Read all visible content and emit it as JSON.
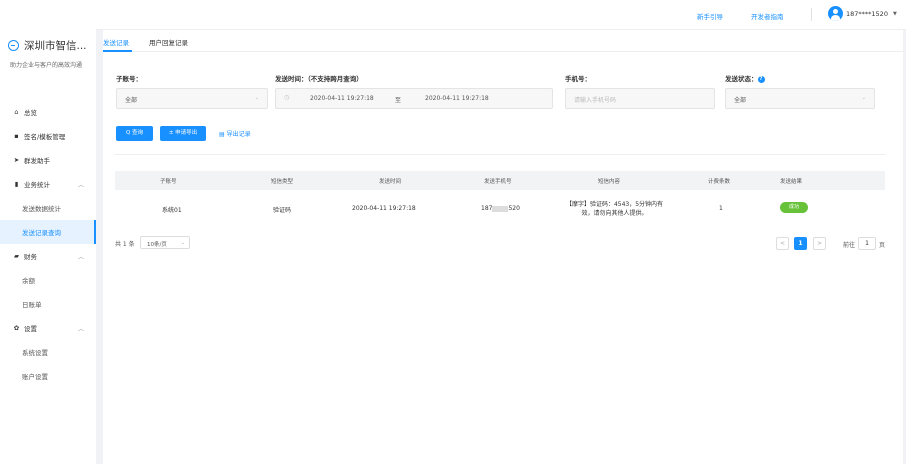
{
  "brand": {
    "name": "深圳市智信...",
    "subtitle": "助力企业与客户的高效沟通"
  },
  "sidebar": {
    "items": [
      {
        "label": "总览",
        "icon": "home-icon",
        "glyph": "⌂"
      },
      {
        "label": "签名/模板管理",
        "icon": "grid-icon",
        "glyph": "▪"
      },
      {
        "label": "群发助手",
        "icon": "send-icon",
        "glyph": "➤"
      },
      {
        "label": "业务统计",
        "icon": "bar-chart-icon",
        "glyph": "▮"
      },
      {
        "label": "发送数据统计"
      },
      {
        "label": "发送记录查询"
      },
      {
        "label": "财务",
        "icon": "wallet-icon",
        "glyph": "▰"
      },
      {
        "label": "余额"
      },
      {
        "label": "日账单"
      },
      {
        "label": "设置",
        "icon": "gear-icon",
        "glyph": "✿"
      },
      {
        "label": "系统设置"
      },
      {
        "label": "账户设置"
      }
    ]
  },
  "header": {
    "guide_link": "新手引导",
    "dev_link": "开发者指南",
    "user": "187****1520"
  },
  "tabs": [
    {
      "label": "发送记录"
    },
    {
      "label": "用户回复记录"
    }
  ],
  "filters": {
    "account": {
      "label": "子账号：",
      "value": "全部"
    },
    "time": {
      "label": "发送时间：（不支持跨月查询）",
      "start": "2020-04-11 19:27:18",
      "separator": "至",
      "end": "2020-04-11 19:27:18"
    },
    "phone": {
      "label": "手机号：",
      "placeholder": "请输入手机号码"
    },
    "status": {
      "label": "发送状态：",
      "value": "全部"
    }
  },
  "actions": {
    "query": "Q 查询",
    "apply_export": "± 申请导出",
    "export_log": "▤ 导出记录"
  },
  "table": {
    "columns": [
      "子账号",
      "短信类型",
      "发送时间",
      "发送手机号",
      "短信内容",
      "计费条数",
      "发送结果"
    ],
    "rows": [
      {
        "account": "系统01",
        "type": "验证码",
        "time": "2020-04-11 19:27:18",
        "phone_prefix": "187",
        "phone_suffix": "520",
        "content": "【摩字】验证码：4543，5分钟内有效，请勿向其他人提供。",
        "count": "1",
        "result": "成功"
      }
    ]
  },
  "pagination": {
    "total": "共 1 条",
    "page_size": "10条/页",
    "prev": "<",
    "current": "1",
    "next": ">",
    "goto_label": "前往",
    "goto_value": "1",
    "goto_unit": "页"
  },
  "colors": {
    "accent": "#1890ff",
    "success": "#67c23a",
    "active_menu_bg": "#e6f2ff"
  }
}
